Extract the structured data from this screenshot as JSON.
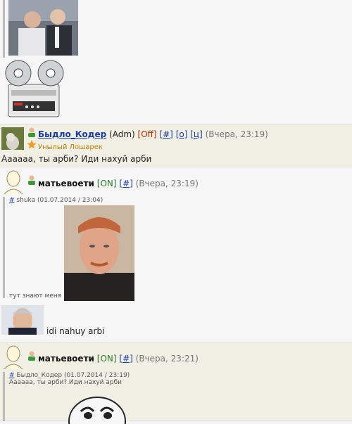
{
  "posts": [
    {
      "id": "p0"
    },
    {
      "username": "Быдло_Кодер",
      "role": "(Adm)",
      "status": "[Off]",
      "links": [
        "[#]",
        "[о]",
        "[ц]"
      ],
      "time": "(Вчера, 23:19)",
      "rank": "Унылый Лошарек",
      "message": "Аааааа, ты арби? Иди нахуй арби"
    },
    {
      "username": "матьевоети",
      "status": "[ON]",
      "link": "[#]",
      "time": "(Вчера, 23:19)",
      "quote": {
        "hash": "#",
        "author": "shuka",
        "date": "(01.07.2014 / 23:04)",
        "text": "тут знают меня"
      },
      "message": "idi nahuy arbi"
    },
    {
      "username": "матьевоети",
      "status": "[ON]",
      "link": "[#]",
      "time": "(Вчера, 23:21)",
      "quote": {
        "hash": "#",
        "author": "Быдло_Кодер",
        "date": "(01.07.2014 / 23:19)",
        "text": "Аааааа, ты арби? Иди нахуй арби"
      }
    }
  ],
  "colors": {
    "link": "#1a3ca8",
    "online": "#2a7a2a",
    "offline": "#cc2200",
    "rank": "#c77a00"
  }
}
